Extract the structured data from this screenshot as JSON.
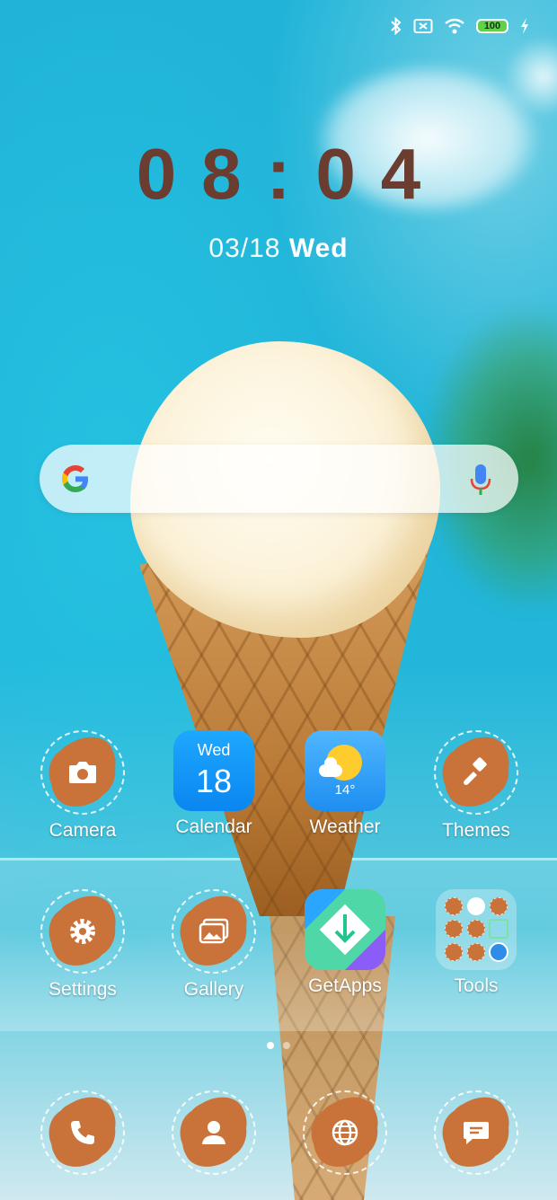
{
  "status_bar": {
    "icons": [
      "bluetooth-icon",
      "no-sim-icon",
      "wifi-icon",
      "battery-icon",
      "charging-icon"
    ],
    "battery_level": "100"
  },
  "clock": {
    "time": "08:04",
    "date": "03/18",
    "weekday": "Wed"
  },
  "search_bar": {
    "logo": "google-g-icon",
    "mic": "microphone-icon"
  },
  "apps_row1": [
    {
      "label": "Camera",
      "icon": "camera-icon"
    },
    {
      "label": "Calendar",
      "icon": "calendar-icon",
      "weekday": "Wed",
      "day": "18"
    },
    {
      "label": "Weather",
      "icon": "weather-icon",
      "temp": "14°"
    },
    {
      "label": "Themes",
      "icon": "paintbrush-icon"
    }
  ],
  "apps_row2": [
    {
      "label": "Settings",
      "icon": "gear-icon"
    },
    {
      "label": "Gallery",
      "icon": "gallery-icon"
    },
    {
      "label": "GetApps",
      "icon": "getapps-icon"
    },
    {
      "label": "Tools",
      "icon": "folder-icon"
    }
  ],
  "page_indicator": {
    "pages": 2,
    "current": 1
  },
  "dock": [
    {
      "icon": "phone-icon"
    },
    {
      "icon": "contacts-icon"
    },
    {
      "icon": "browser-icon"
    },
    {
      "icon": "messages-icon"
    }
  ],
  "colors": {
    "clock": "#6b3d31",
    "icon_brush": "#c9733a",
    "wallpaper_sky": "#20b4d8"
  }
}
